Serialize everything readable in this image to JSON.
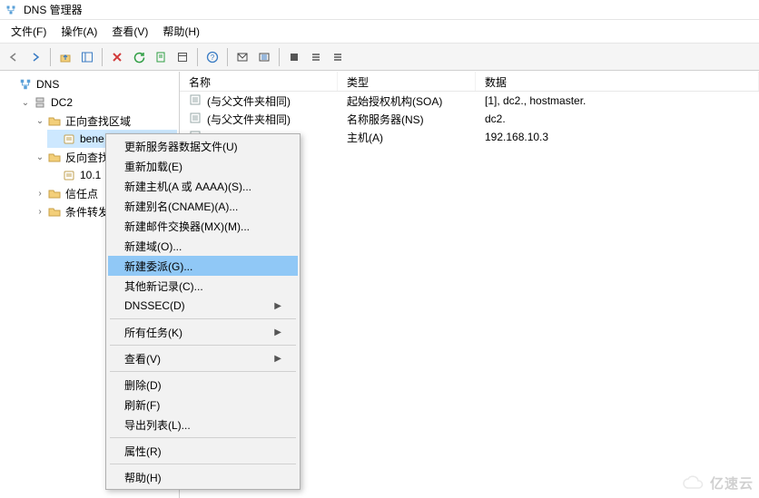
{
  "window": {
    "title": "DNS 管理器"
  },
  "menubar": {
    "file": "文件(F)",
    "action": "操作(A)",
    "view": "查看(V)",
    "help": "帮助(H)"
  },
  "tree": {
    "root": "DNS",
    "server": "DC2",
    "fwd_zone": "正向查找区域",
    "fwd_child": "bene",
    "rev_zone": "反向查找",
    "rev_child": "10.1",
    "trust": "信任点",
    "cond": "条件转发"
  },
  "columns": {
    "name": "名称",
    "type": "类型",
    "data": "数据"
  },
  "records": [
    {
      "name": "(与父文件夹相同)",
      "type": "起始授权机构(SOA)",
      "data": "[1], dc2., hostmaster."
    },
    {
      "name": "(与父文件夹相同)",
      "type": "名称服务器(NS)",
      "data": "dc2."
    },
    {
      "name": "",
      "type": "主机(A)",
      "data": "192.168.10.3"
    }
  ],
  "context": {
    "update_data": "更新服务器数据文件(U)",
    "reload": "重新加载(E)",
    "new_host": "新建主机(A 或 AAAA)(S)...",
    "new_cname": "新建别名(CNAME)(A)...",
    "new_mx": "新建邮件交换器(MX)(M)...",
    "new_domain": "新建域(O)...",
    "new_deleg": "新建委派(G)...",
    "other_new": "其他新记录(C)...",
    "dnssec": "DNSSEC(D)",
    "all_tasks": "所有任务(K)",
    "view": "查看(V)",
    "delete": "删除(D)",
    "refresh": "刷新(F)",
    "export_list": "导出列表(L)...",
    "properties": "属性(R)",
    "help": "帮助(H)"
  },
  "watermark": {
    "text": "亿速云"
  }
}
